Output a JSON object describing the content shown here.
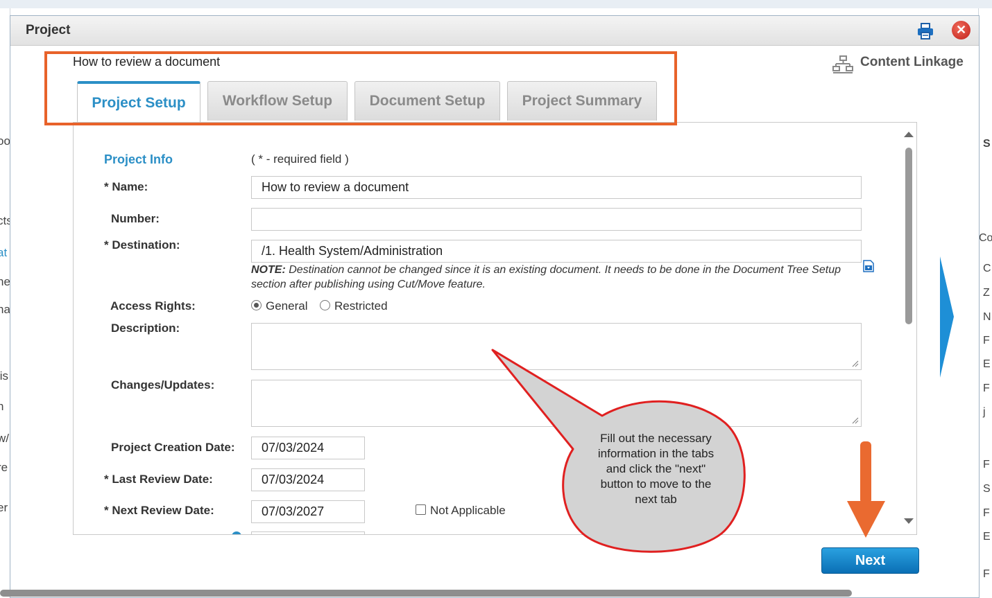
{
  "dialog": {
    "title": "Project",
    "document_title": "How to review a document",
    "content_linkage_label": "Content Linkage"
  },
  "tabs": [
    {
      "label": "Project Setup",
      "active": true
    },
    {
      "label": "Workflow Setup",
      "active": false
    },
    {
      "label": "Document Setup",
      "active": false
    },
    {
      "label": "Project Summary",
      "active": false
    }
  ],
  "form": {
    "section_label": "Project Info",
    "required_note": "( * - required field )",
    "name_label": "* Name:",
    "name_value": "How to review a document",
    "number_label": "Number:",
    "number_value": "",
    "destination_label": "* Destination:",
    "destination_value": "/1. Health System/Administration",
    "note_prefix": "NOTE:",
    "note_text": " Destination cannot be changed since it is an existing document. It needs to be done in the Document Tree Setup section after publishing using Cut/Move feature.",
    "access_rights_label": "Access Rights:",
    "access_general": "General",
    "access_restricted": "Restricted",
    "access_selected": "General",
    "description_label": "Description:",
    "changes_label": "Changes/Updates:",
    "creation_date_label": "Project Creation Date:",
    "creation_date_value": "07/03/2024",
    "last_review_label": "*  Last Review Date:",
    "last_review_value": "07/03/2024",
    "next_review_label": "*  Next Review Date:",
    "next_review_value": "07/03/2027",
    "not_applicable_label": "Not Applicable",
    "not_applicable_checked": false
  },
  "buttons": {
    "next_label": "Next"
  },
  "annotation": {
    "callout_text": "Fill out the necessary information in the tabs and click the \"next\" button to move to the next tab",
    "highlight_color": "#e8622a",
    "arrow_color": "#ea6a30",
    "callout_border_color": "#e02020"
  },
  "background": {
    "left_fragments": [
      "oo",
      "cts",
      "at",
      "ne",
      "ha",
      "lis",
      "n",
      "w/l",
      "re",
      "er"
    ],
    "right_fragments": [
      "S",
      "Co",
      "C",
      "Z",
      "N",
      "F",
      "E",
      "F",
      "j",
      "F",
      "S",
      "F",
      "E",
      "F"
    ]
  },
  "icons": {
    "print": "printer-icon",
    "close": "close-icon",
    "linkage": "sitemap-icon",
    "destination_picker": "document-picker-icon"
  }
}
